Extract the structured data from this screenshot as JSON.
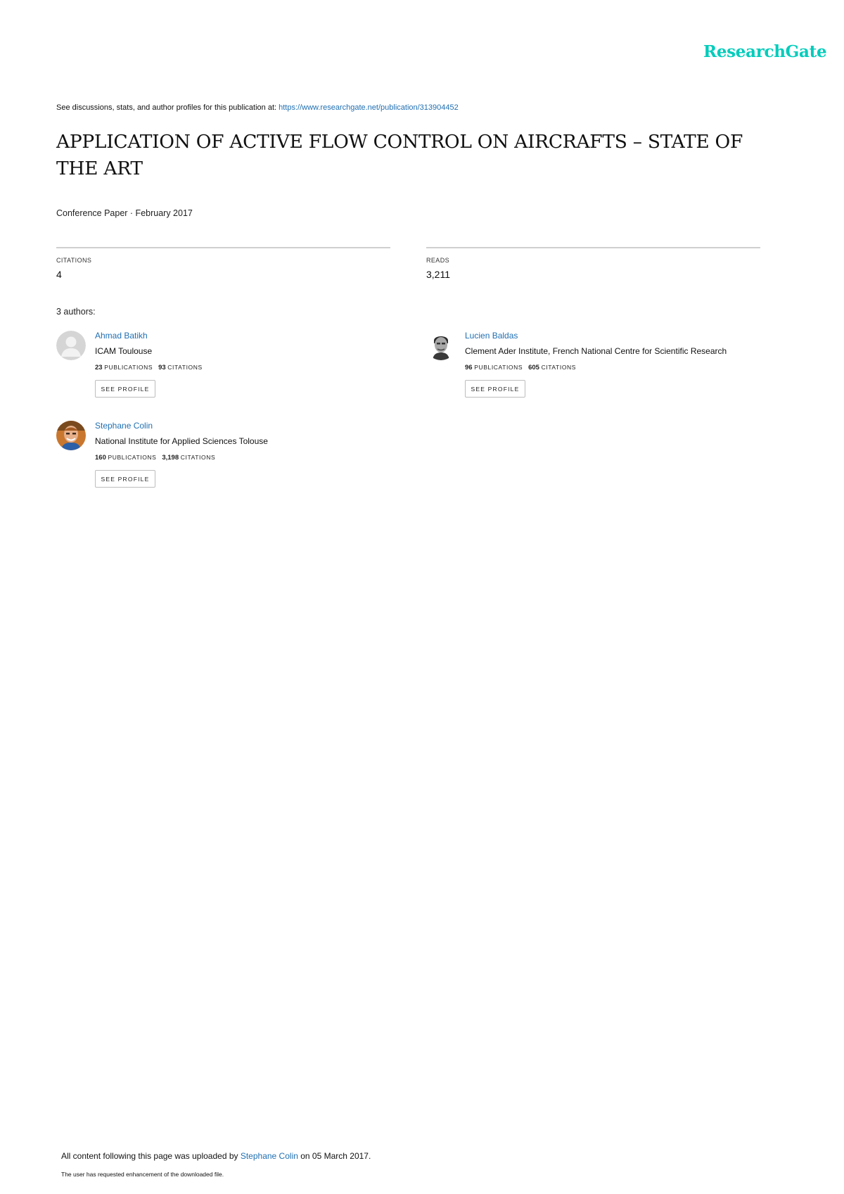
{
  "header": {
    "logo_text": "ResearchGate",
    "logo_color": "#00ccbb"
  },
  "discussion": {
    "prefix": "See discussions, stats, and author profiles for this publication at: ",
    "url": "https://www.researchgate.net/publication/313904452"
  },
  "paper": {
    "title": "APPLICATION OF ACTIVE FLOW CONTROL ON AIRCRAFTS – STATE OF THE ART",
    "type_date": "Conference Paper · February 2017"
  },
  "stats": {
    "citations_label": "CITATIONS",
    "citations_value": "4",
    "reads_label": "READS",
    "reads_value": "3,211"
  },
  "authors_count": "3 authors:",
  "authors": [
    {
      "name": "Ahmad Batikh",
      "institution": "ICAM Toulouse",
      "publications": "23",
      "publications_label": "PUBLICATIONS",
      "citations": "93",
      "citations_label": "CITATIONS",
      "button": "SEE PROFILE"
    },
    {
      "name": "Lucien Baldas",
      "institution": "Clement Ader Institute, French National Centre for Scientific Research",
      "publications": "96",
      "publications_label": "PUBLICATIONS",
      "citations": "605",
      "citations_label": "CITATIONS",
      "button": "SEE PROFILE"
    },
    {
      "name": "Stephane Colin",
      "institution": "National Institute for Applied Sciences Tolouse",
      "publications": "160",
      "publications_label": "PUBLICATIONS",
      "citations": "3,198",
      "citations_label": "CITATIONS",
      "button": "SEE PROFILE"
    }
  ],
  "footer": {
    "upload_prefix": "All content following this page was uploaded by ",
    "uploader": "Stephane Colin",
    "upload_suffix": " on 05 March 2017.",
    "note": "The user has requested enhancement of the downloaded file."
  }
}
